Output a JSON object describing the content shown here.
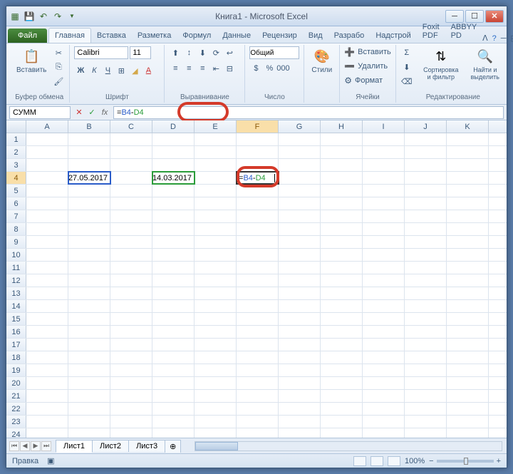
{
  "title": "Книга1 - Microsoft Excel",
  "tabs": {
    "file": "Файл",
    "items": [
      "Главная",
      "Вставка",
      "Разметка",
      "Формул",
      "Данные",
      "Рецензир",
      "Вид",
      "Разрабо",
      "Надстрой",
      "Foxit PDF",
      "ABBYY PD"
    ]
  },
  "ribbon": {
    "clipboard": {
      "paste": "Вставить",
      "label": "Буфер обмена"
    },
    "font": {
      "name": "Calibri",
      "size": "11",
      "label": "Шрифт"
    },
    "align": {
      "label": "Выравнивание"
    },
    "number": {
      "format": "Общий",
      "label": "Число"
    },
    "styles": {
      "btn": "Стили"
    },
    "cells": {
      "insert": "Вставить",
      "delete": "Удалить",
      "format": "Формат",
      "label": "Ячейки"
    },
    "editing": {
      "sort": "Сортировка и фильтр",
      "find": "Найти и выделить",
      "label": "Редактирование"
    }
  },
  "namebox": "СУММ",
  "formula": "=B4-D4",
  "cells": {
    "B4": "27.05.2017",
    "D4": "14.03.2017",
    "F4": "=B4-D4"
  },
  "columns": [
    "A",
    "B",
    "C",
    "D",
    "E",
    "F",
    "G",
    "H",
    "I",
    "J",
    "K"
  ],
  "rows": 24,
  "sheets": [
    "Лист1",
    "Лист2",
    "Лист3"
  ],
  "status": "Правка",
  "zoom": "100%"
}
